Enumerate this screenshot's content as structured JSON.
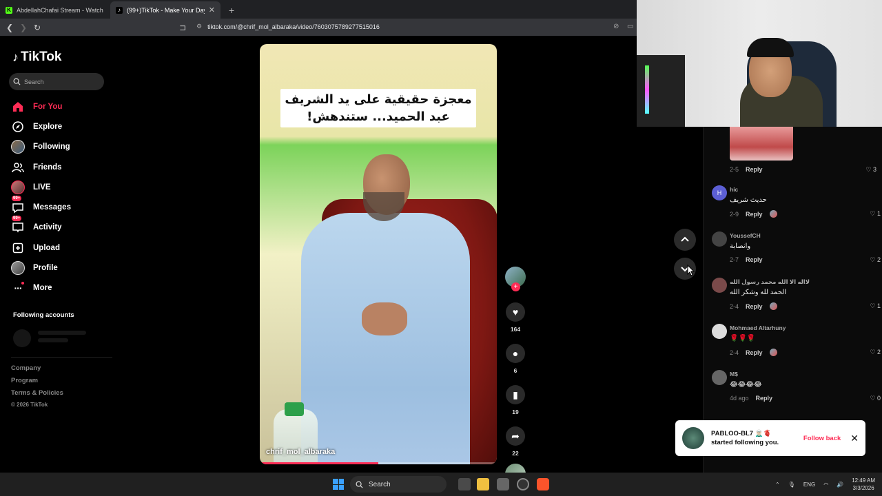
{
  "browser": {
    "tabs": [
      {
        "title": "AbdellahChafai Stream - Watch Live",
        "active": false
      },
      {
        "title": "(99+)TikTok - Make Your Day",
        "active": true
      }
    ],
    "url": "tiktok.com/@chrif_mol_albaraka/video/7603075789277515016"
  },
  "sidebar": {
    "logo": "TikTok",
    "search_placeholder": "Search",
    "items": [
      {
        "label": "For You",
        "icon": "home-icon",
        "active": true
      },
      {
        "label": "Explore",
        "icon": "compass-icon"
      },
      {
        "label": "Following",
        "icon": "avatar-icon"
      },
      {
        "label": "Friends",
        "icon": "friends-icon"
      },
      {
        "label": "LIVE",
        "icon": "live-icon"
      },
      {
        "label": "Messages",
        "icon": "messages-icon",
        "badge": "99+"
      },
      {
        "label": "Activity",
        "icon": "activity-icon",
        "badge": "99+"
      },
      {
        "label": "Upload",
        "icon": "upload-icon"
      },
      {
        "label": "Profile",
        "icon": "profile-avatar-icon"
      },
      {
        "label": "More",
        "icon": "more-icon"
      }
    ],
    "following_accounts": "Following accounts",
    "footer": [
      "Company",
      "Program",
      "Terms & Policies",
      "© 2026 TikTok"
    ]
  },
  "video": {
    "caption": "معجزة حقيقية على يد الشريف عبد الحميد... ستندهش!",
    "username": "chrif_mol_albaraka",
    "progress": 0.5
  },
  "actions": {
    "likes": "164",
    "comments": "6",
    "saves": "19",
    "shares": "22"
  },
  "comments": {
    "top_meta": {
      "time": "2-5",
      "reply": "Reply",
      "likes": "3"
    },
    "items": [
      {
        "avatar": "H",
        "username": "hic",
        "text": "حديث شريف",
        "time": "2-9",
        "reply": "Reply",
        "likes": "1",
        "creator_liked": true,
        "avatar_color": "#5c5fd4"
      },
      {
        "avatar": "",
        "username": "YoussefCH",
        "text": "وانصابة",
        "time": "2-7",
        "reply": "Reply",
        "likes": "2",
        "creator_liked": false,
        "avatar_color": "#444"
      },
      {
        "avatar": "",
        "username": "لااله الا الله محمد رسول الله",
        "text": "الحمد لله وشكر الله",
        "time": "2-4",
        "reply": "Reply",
        "likes": "1",
        "creator_liked": true,
        "avatar_color": "#7a4a4a"
      },
      {
        "avatar": "",
        "username": "Mohmaed Altarhuny",
        "text": "🌹🌹🌹",
        "time": "2-4",
        "reply": "Reply",
        "likes": "2",
        "creator_liked": true,
        "avatar_color": "#ddd"
      },
      {
        "avatar": "",
        "username": "M$",
        "text": "😂😂😂😂",
        "time": "4d ago",
        "reply": "Reply",
        "likes": "0",
        "creator_liked": false,
        "avatar_color": "#666"
      }
    ]
  },
  "toast": {
    "name": "PABLOO-BL7 🧝🏻‍♂️🫀",
    "message": "started following you.",
    "action": "Follow back"
  },
  "taskbar": {
    "search": "Search",
    "lang": "ENG",
    "time": "12:49 AM",
    "date": "3/3/2026"
  },
  "colors": {
    "accent": "#fe2c55",
    "background": "#000000"
  }
}
